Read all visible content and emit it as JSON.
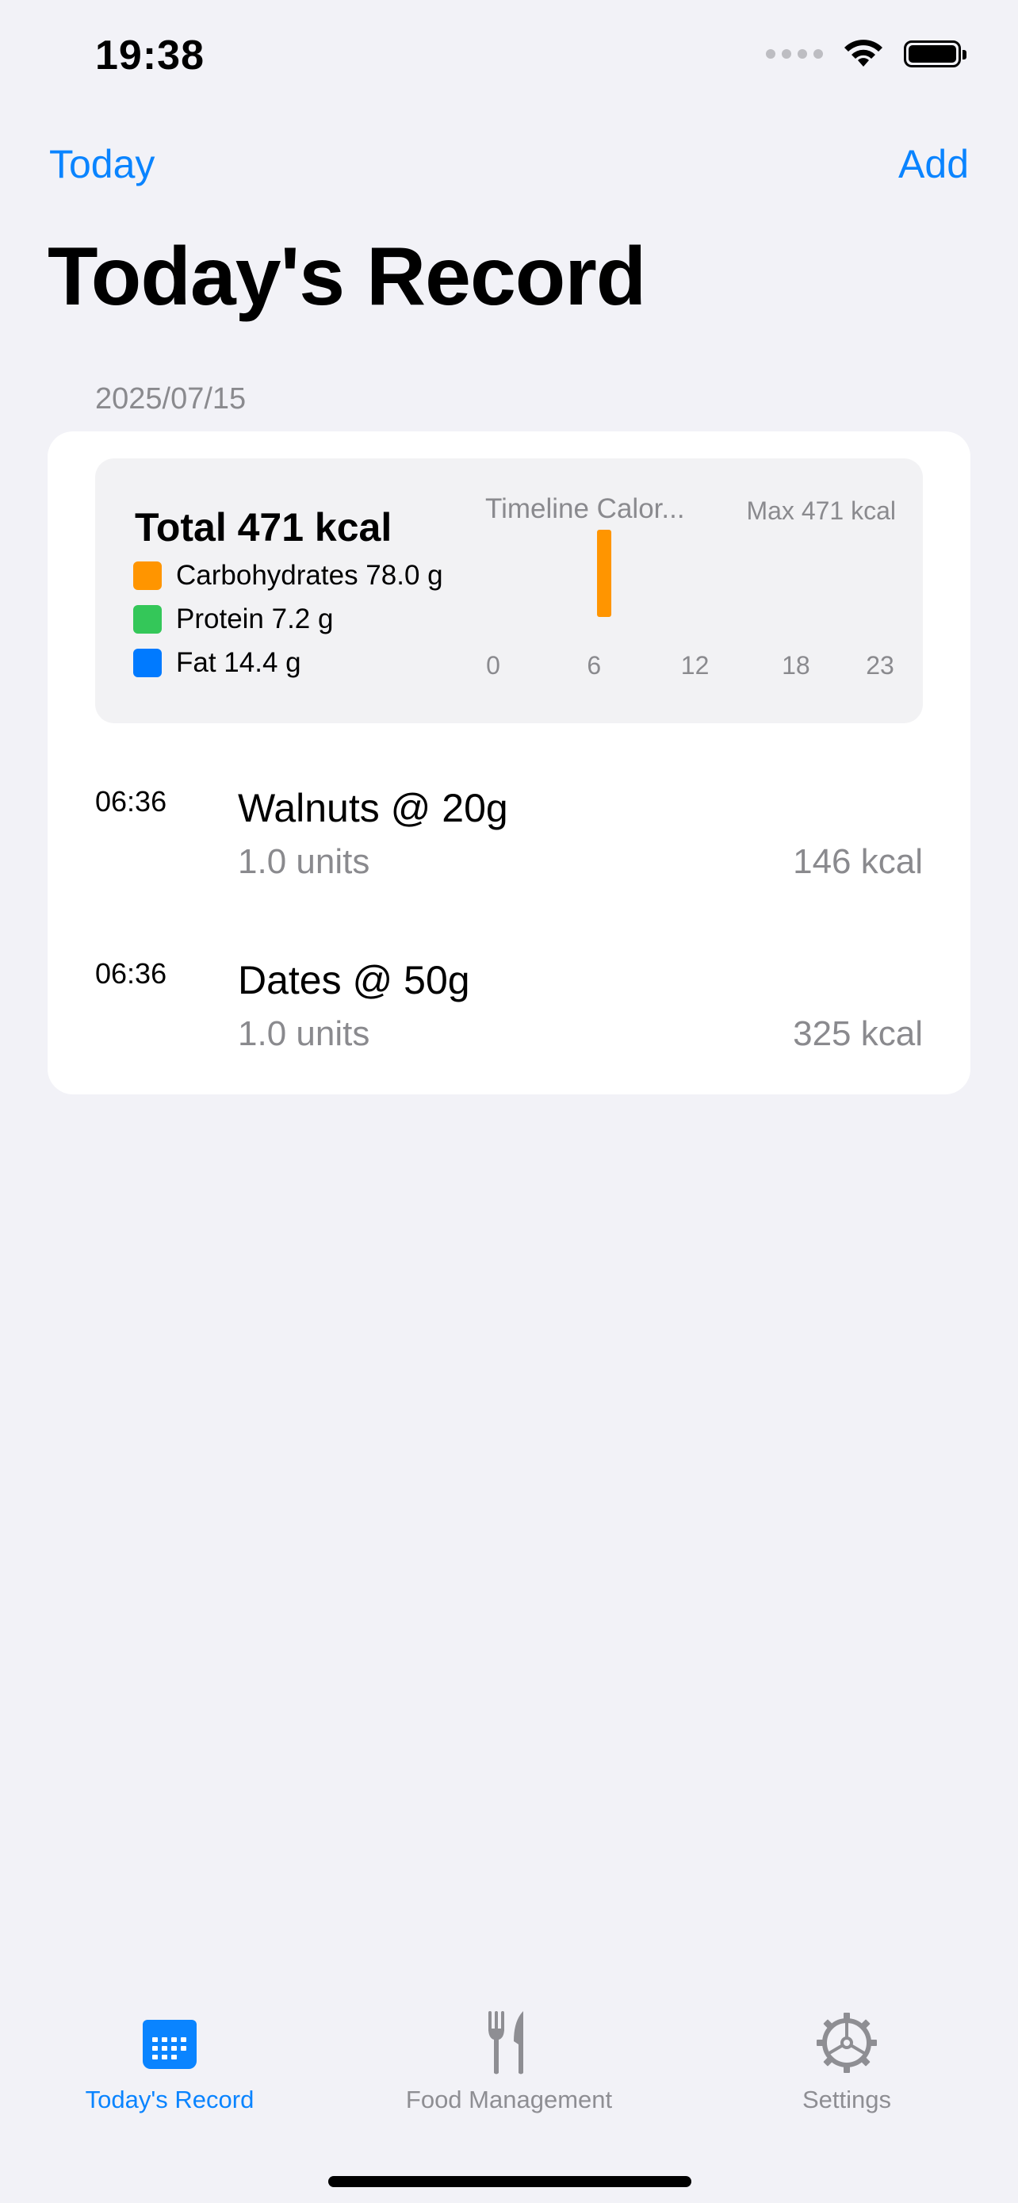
{
  "status": {
    "time": "19:38"
  },
  "nav": {
    "left": "Today",
    "right": "Add",
    "title": "Today's Record"
  },
  "section": {
    "date": "2025/07/15"
  },
  "summary": {
    "total": "Total 471 kcal",
    "macros": [
      {
        "label": "Carbohydrates 78.0 g",
        "color": "#FF9500"
      },
      {
        "label": "Protein 7.2 g",
        "color": "#34C759"
      },
      {
        "label": "Fat 14.4 g",
        "color": "#007AFF"
      }
    ]
  },
  "chart_data": {
    "type": "bar",
    "title": "Timeline Calor...",
    "annotation": "Max 471 kcal",
    "x_ticks": [
      "0",
      "6",
      "12",
      "18",
      "23"
    ],
    "xlim": [
      0,
      23
    ],
    "ylim": [
      0,
      471
    ],
    "x": [
      6.6
    ],
    "values": [
      471
    ],
    "bar_color": "#FF9500"
  },
  "entries": [
    {
      "time": "06:36",
      "name": "Walnuts @ 20g",
      "units": "1.0 units",
      "kcal": "146 kcal"
    },
    {
      "time": "06:36",
      "name": "Dates @ 50g",
      "units": "1.0 units",
      "kcal": "325 kcal"
    }
  ],
  "tabs": [
    {
      "label": "Today's Record",
      "icon": "calendar-icon",
      "active": true
    },
    {
      "label": "Food Management",
      "icon": "fork-knife-icon",
      "active": false
    },
    {
      "label": "Settings",
      "icon": "gear-icon",
      "active": false
    }
  ],
  "colors": {
    "accent": "#0A84FF",
    "secondary": "#8A8A8E",
    "background": "#F2F2F7"
  }
}
